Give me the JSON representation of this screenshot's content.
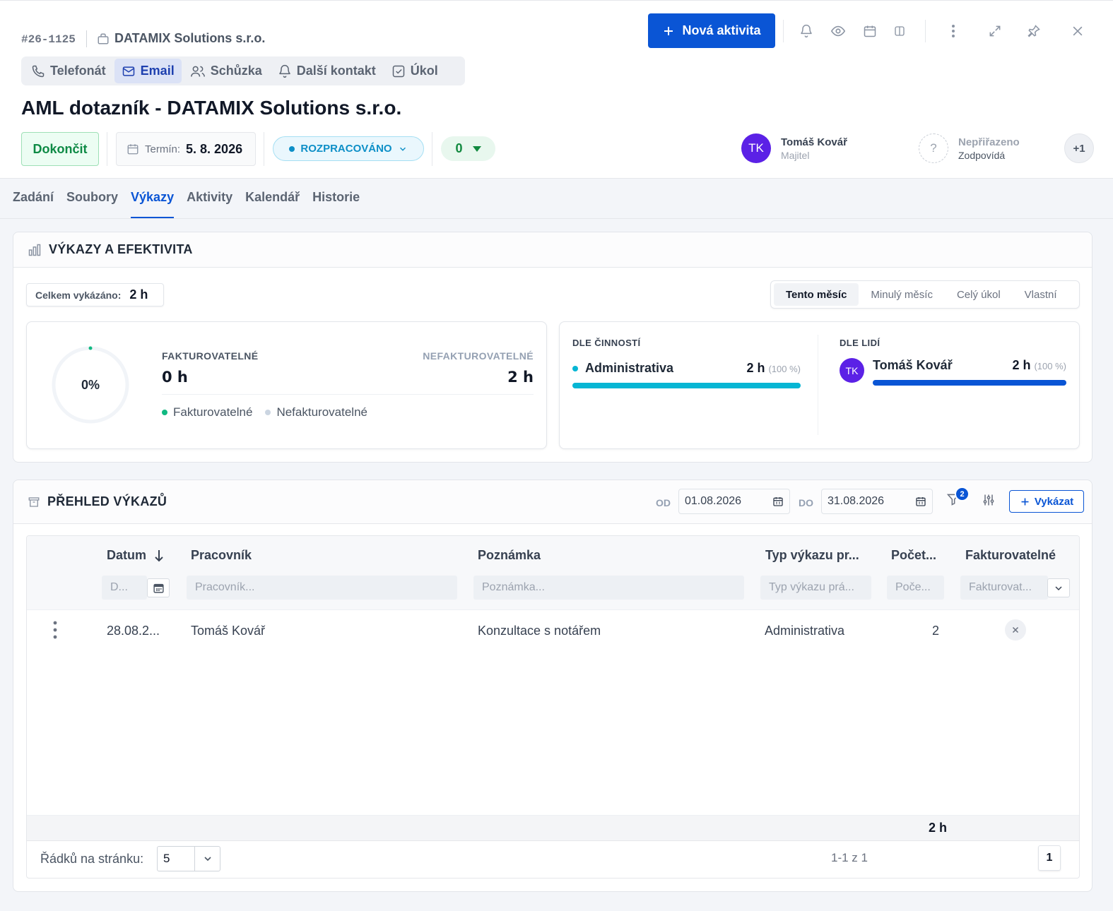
{
  "record": {
    "id": "#26-1125",
    "company": "DATAMIX Solutions s.r.o.",
    "title": "AML dotazník - DATAMIX Solutions s.r.o."
  },
  "toolbar": {
    "new_activity_label": "Nová aktivita",
    "icons": [
      "bell-icon",
      "eye-icon",
      "calendar-icon",
      "split-view-icon",
      "more-vertical-icon",
      "expand-icon",
      "pin-icon",
      "close-icon"
    ]
  },
  "contact_types": [
    {
      "label": "Telefonát",
      "icon": "phone-icon"
    },
    {
      "label": "Email",
      "icon": "mail-icon",
      "active": true
    },
    {
      "label": "Schůzka",
      "icon": "users-icon"
    },
    {
      "label": "Další kontakt",
      "icon": "bell-icon"
    },
    {
      "label": "Úkol",
      "icon": "checkbox-icon"
    }
  ],
  "actions": {
    "finish_label": "Dokončit",
    "deadline_label": "Termín:",
    "deadline_value": "5. 8. 2026",
    "status_label": "ROZPRACOVÁNO",
    "count_value": "0"
  },
  "people": {
    "owner": {
      "initials": "TK",
      "name": "Tomáš Kovář",
      "role": "Majitel"
    },
    "assignee": {
      "initials": "?",
      "name": "Nepřiřazeno",
      "role": "Zodpovídá"
    },
    "more": "+1"
  },
  "tabs": [
    {
      "label": "Zadání"
    },
    {
      "label": "Soubory"
    },
    {
      "label": "Výkazy",
      "active": true
    },
    {
      "label": "Aktivity"
    },
    {
      "label": "Kalendář"
    },
    {
      "label": "Historie"
    }
  ],
  "efficiency": {
    "title": "VÝKAZY A EFEKTIVITA",
    "total_label": "Celkem vykázáno:",
    "total_value": "2 h",
    "periods": [
      {
        "label": "Tento měsíc",
        "active": true
      },
      {
        "label": "Minulý měsíc"
      },
      {
        "label": "Celý úkol"
      },
      {
        "label": "Vlastní"
      }
    ],
    "billable_percent_text": "0%",
    "billable_fraction": 0,
    "billable_label": "FAKTUROVATELNÉ",
    "billable_value": "0 h",
    "nonbillable_label": "NEFAKTUROVATELNÉ",
    "nonbillable_value": "2 h",
    "legend_billable": "Fakturovatelné",
    "legend_nonbillable": "Nefakturovatelné",
    "colors": {
      "billable": "#10b981",
      "nonbillable": "#cbd5e1",
      "activity": "#06b6d4",
      "person": "#0a55d5"
    },
    "by_activity_label": "DLE ČINNOSTÍ",
    "by_activity": [
      {
        "name": "Administrativa",
        "hours": "2 h",
        "percent": "(100 %)",
        "fraction": 1
      }
    ],
    "by_people_label": "DLE LIDÍ",
    "by_people": [
      {
        "initials": "TK",
        "name": "Tomáš Kovář",
        "hours": "2 h",
        "percent": "(100 %)",
        "fraction": 1
      }
    ]
  },
  "reports": {
    "title": "PŘEHLED VÝKAZŮ",
    "from_label": "OD",
    "from_value": "01.08.2026",
    "to_label": "DO",
    "to_value": "31.08.2026",
    "filter_count": "2",
    "add_label": "Vykázat",
    "columns": [
      "Datum",
      "Pracovník",
      "Poznámka",
      "Typ výkazu pr...",
      "Počet...",
      "Fakturovatelné"
    ],
    "filters": [
      "D...",
      "Pracovník...",
      "Poznámka...",
      "Typ výkazu prá...",
      "Poče...",
      "Fakturovat..."
    ],
    "rows": [
      {
        "date": "28.08.2...",
        "worker": "Tomáš Kovář",
        "note": "Konzultace s notářem",
        "type": "Administrativa",
        "count": "2",
        "billable": false
      }
    ],
    "sum": "2 h",
    "per_page_label": "Řádků na stránku:",
    "per_page_value": "5",
    "range_info": "1-1 z 1",
    "page": "1"
  }
}
